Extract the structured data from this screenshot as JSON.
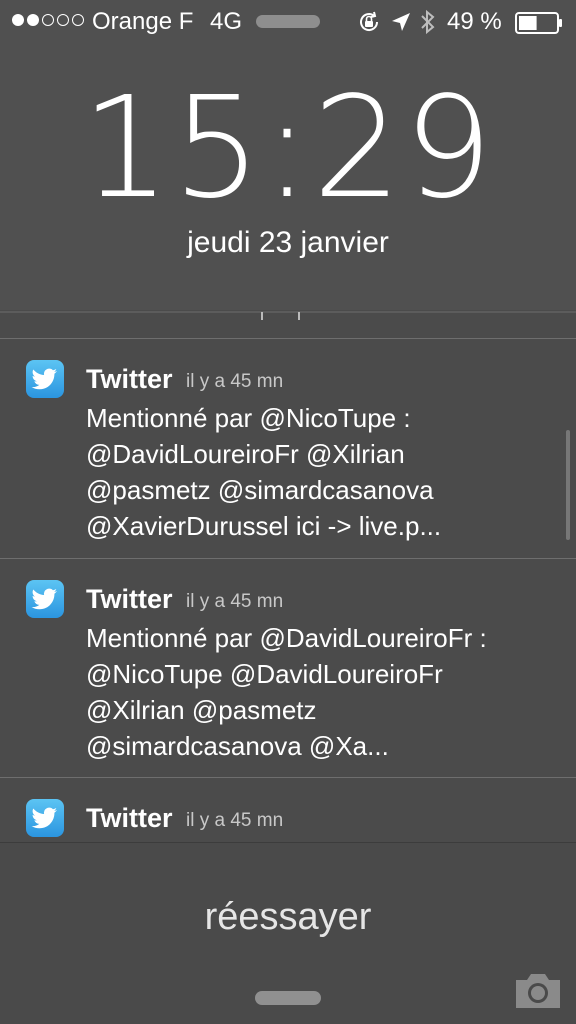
{
  "status_bar": {
    "signal_icon": "signal-dots-icon",
    "carrier": "Orange F",
    "network": "4G",
    "icons": [
      "orientation-lock-icon",
      "location-arrow-icon",
      "bluetooth-icon"
    ],
    "battery_percent_text": "49 %",
    "battery_level": 0.49
  },
  "lock_screen": {
    "time": "15:29",
    "date": "jeudi 23 janvier"
  },
  "notifications": [
    {
      "app": "Twitter",
      "icon": "twitter-bird-icon",
      "time": "il y a 45 mn",
      "body": "Mentionné par @NicoTupe :\n@DavidLoureiroFr @Xilrian\n@pasmetz @simardcasanova\n@XavierDurussel ici -> live.p..."
    },
    {
      "app": "Twitter",
      "icon": "twitter-bird-icon",
      "time": "il y a 45 mn",
      "body": "Mentionné par @DavidLoureiroFr :\n@NicoTupe @DavidLoureiroFr\n@Xilrian @pasmetz\n@simardcasanova @Xa..."
    },
    {
      "app": "Twitter",
      "icon": "twitter-bird-icon",
      "time": "il y a 45 mn",
      "body": ""
    }
  ],
  "retry_label": "réessayer",
  "camera_icon": "camera-icon"
}
